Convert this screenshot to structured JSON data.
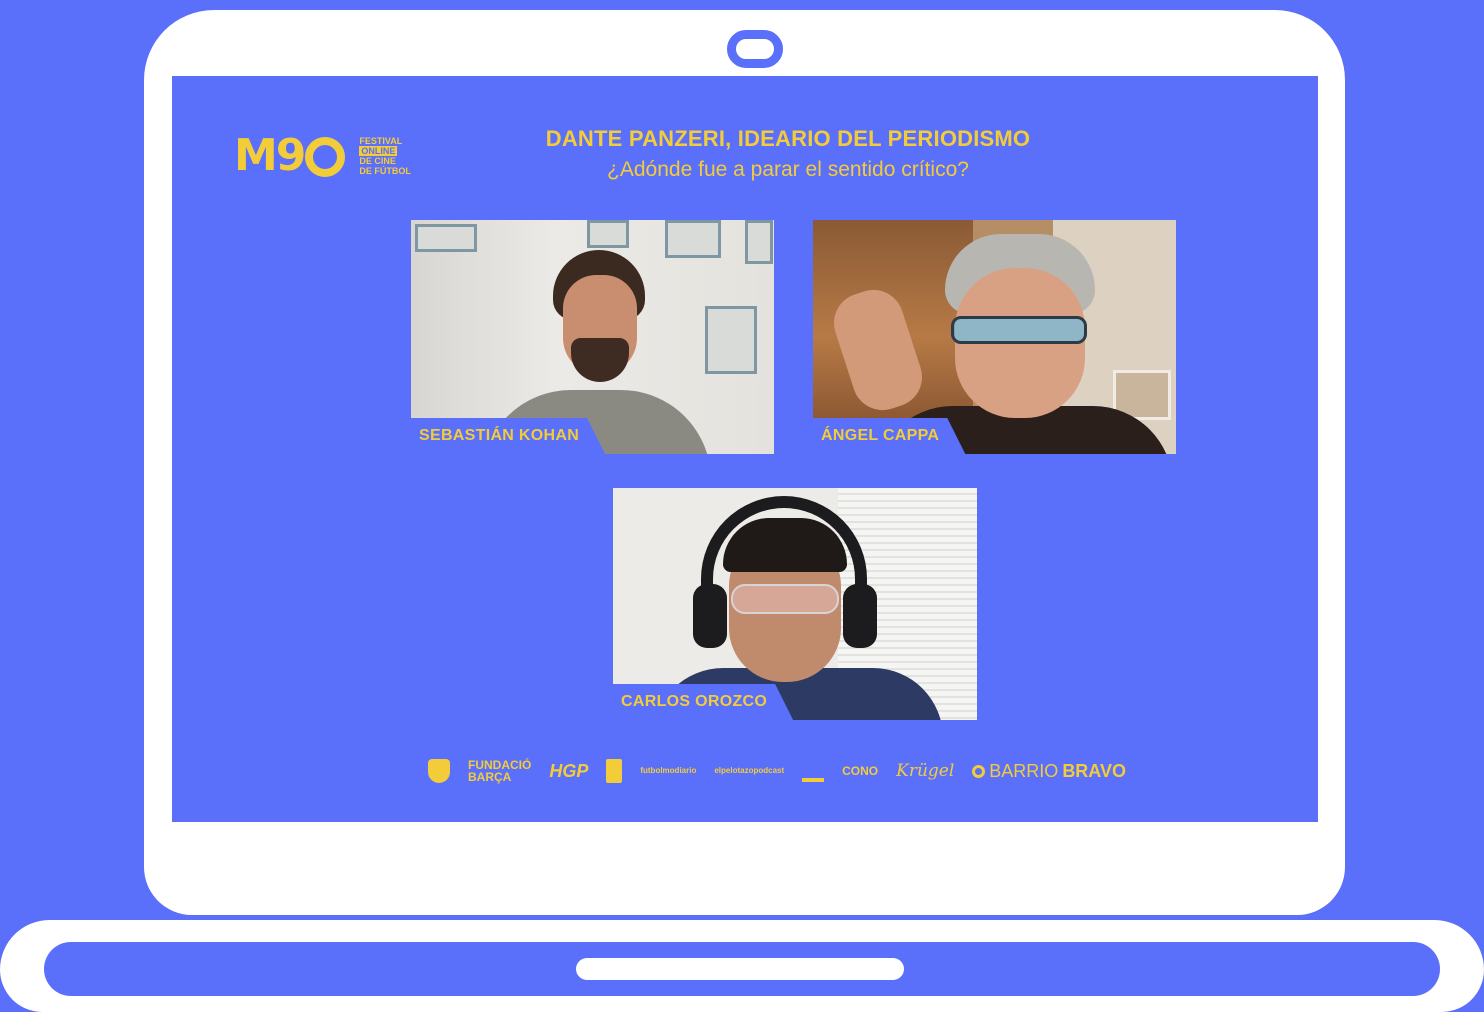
{
  "colors": {
    "background": "#5a6ffa",
    "accent": "#f3cc3a",
    "device": "#ffffff"
  },
  "event": {
    "logo_mark": "M9",
    "logo_line1": "FESTIVAL",
    "logo_line2": "ONLINE",
    "logo_line3": "DE CINE",
    "logo_line4": "DE FÚTBOL",
    "title": "DANTE PANZERI, IDEARIO DEL PERIODISMO",
    "subtitle": "¿Adónde fue a parar el sentido crítico?"
  },
  "participants": [
    {
      "name": "SEBASTIÁN KOHAN"
    },
    {
      "name": "ÁNGEL CAPPA"
    },
    {
      "name": "CARLOS OROZCO"
    }
  ],
  "sponsors": {
    "fundacio_line1": "FUNDACIÓ",
    "fundacio_line2": "BARÇA",
    "hgp": "HGP",
    "podcast1": "futbolmodiario",
    "podcast2": "elpelotazopodcast",
    "cono": "CONO",
    "krugel": "Krügel",
    "barrio": "BARRIO",
    "bravo": "BRAVO"
  }
}
